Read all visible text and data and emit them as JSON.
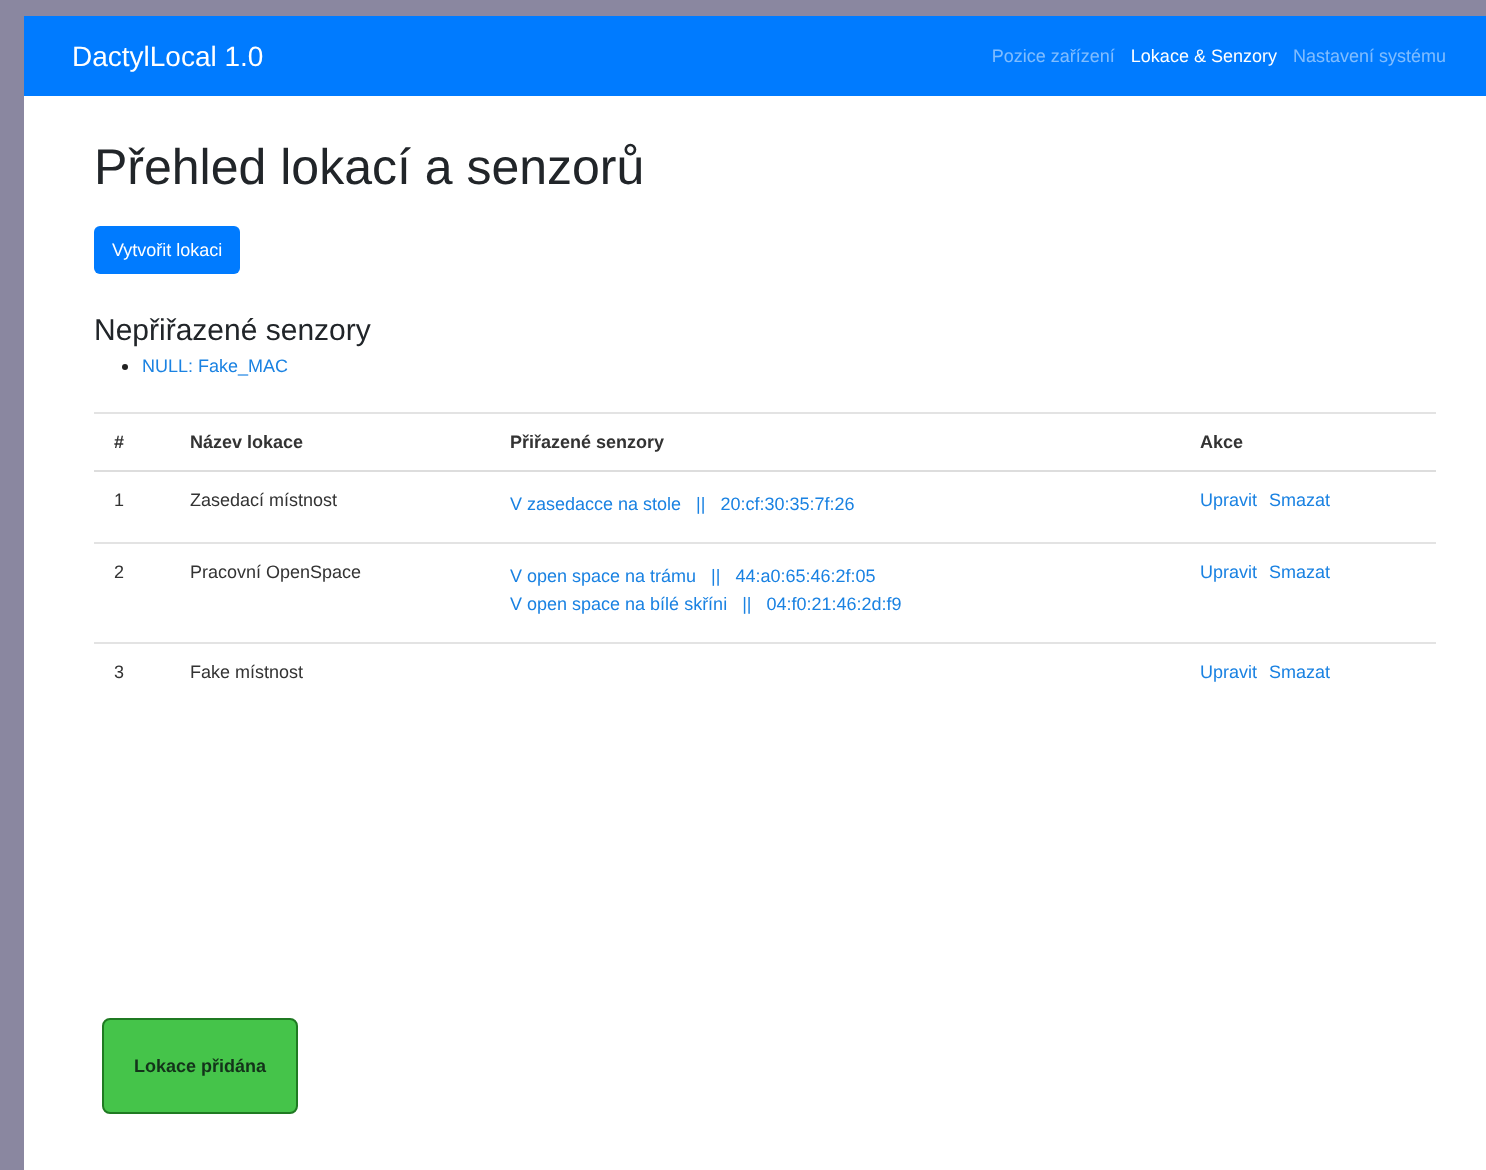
{
  "navbar": {
    "brand": "DactylLocal 1.0",
    "links": [
      {
        "label": "Pozice zařízení",
        "selected": false
      },
      {
        "label": "Lokace & Senzory",
        "selected": true
      },
      {
        "label": "Nastavení systému",
        "selected": false
      }
    ]
  },
  "page_title": "Přehled lokací a senzorů",
  "create_button": "Vytvořit lokaci",
  "unassigned": {
    "heading": "Nepřiřazené senzory",
    "items": [
      "NULL: Fake_MAC"
    ]
  },
  "table": {
    "columns": [
      "#",
      "Název lokace",
      "Přiřazené senzory",
      "Akce"
    ],
    "rows": [
      {
        "number": "1",
        "name": "Zasedací místnost",
        "sensors": [
          {
            "name": "V zasedacce na stole",
            "separator": "||",
            "mac": "20:cf:30:35:7f:26"
          }
        ],
        "actions": [
          "Upravit",
          "Smazat"
        ]
      },
      {
        "number": "2",
        "name": "Pracovní OpenSpace",
        "sensors": [
          {
            "name": "V open space na trámu",
            "separator": "||",
            "mac": "44:a0:65:46:2f:05"
          },
          {
            "name": "V open space na bílé skříni",
            "separator": "||",
            "mac": "04:f0:21:46:2d:f9"
          }
        ],
        "actions": [
          "Upravit",
          "Smazat"
        ]
      },
      {
        "number": "3",
        "name": "Fake místnost",
        "sensors": [],
        "actions": [
          "Upravit",
          "Smazat"
        ]
      }
    ]
  },
  "toast": "Lokace přidána"
}
